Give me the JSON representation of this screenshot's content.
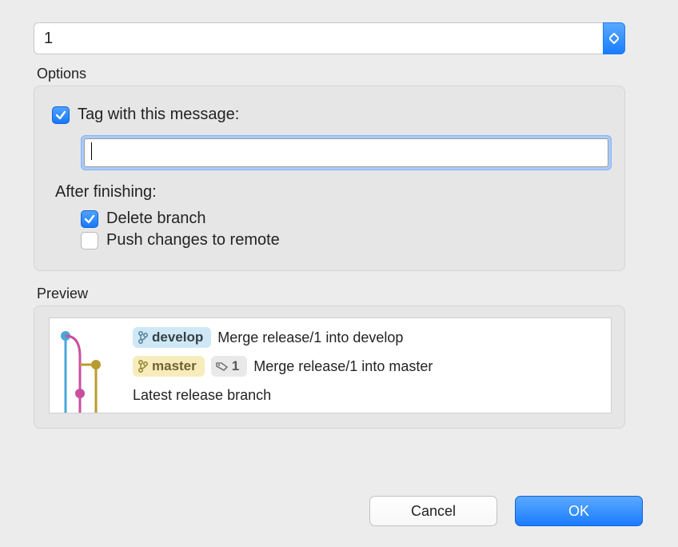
{
  "release_select": {
    "value": "1"
  },
  "sections": {
    "options_label": "Options",
    "preview_label": "Preview"
  },
  "options": {
    "tag_message_label": "Tag with this message:",
    "tag_message_checked": true,
    "tag_message_value": "",
    "after_finishing_label": "After finishing:",
    "delete_branch_label": "Delete branch",
    "delete_branch_checked": true,
    "push_remote_label": "Push changes to remote",
    "push_remote_checked": false
  },
  "preview": {
    "rows": [
      {
        "chips": [
          {
            "kind": "develop",
            "label": "develop"
          }
        ],
        "text": "Merge release/1 into develop"
      },
      {
        "chips": [
          {
            "kind": "master",
            "label": "master"
          },
          {
            "kind": "tag",
            "label": "1"
          }
        ],
        "text": "Merge release/1 into master"
      },
      {
        "chips": [],
        "text": "Latest release branch"
      }
    ]
  },
  "buttons": {
    "cancel": "Cancel",
    "ok": "OK"
  }
}
